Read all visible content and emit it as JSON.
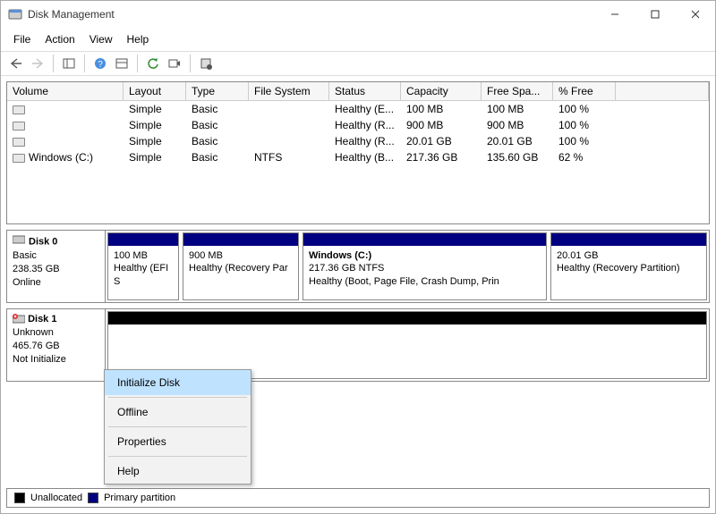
{
  "window": {
    "title": "Disk Management"
  },
  "menubar": {
    "file": "File",
    "action": "Action",
    "view": "View",
    "help": "Help"
  },
  "columns": {
    "volume": "Volume",
    "layout": "Layout",
    "type": "Type",
    "fs": "File System",
    "status": "Status",
    "capacity": "Capacity",
    "free": "Free Spa...",
    "pct": "% Free"
  },
  "volumes": [
    {
      "name": "",
      "layout": "Simple",
      "type": "Basic",
      "fs": "",
      "status": "Healthy (E...",
      "capacity": "100 MB",
      "free": "100 MB",
      "pct": "100 %"
    },
    {
      "name": "",
      "layout": "Simple",
      "type": "Basic",
      "fs": "",
      "status": "Healthy (R...",
      "capacity": "900 MB",
      "free": "900 MB",
      "pct": "100 %"
    },
    {
      "name": "",
      "layout": "Simple",
      "type": "Basic",
      "fs": "",
      "status": "Healthy (R...",
      "capacity": "20.01 GB",
      "free": "20.01 GB",
      "pct": "100 %"
    },
    {
      "name": "Windows (C:)",
      "layout": "Simple",
      "type": "Basic",
      "fs": "NTFS",
      "status": "Healthy (B...",
      "capacity": "217.36 GB",
      "free": "135.60 GB",
      "pct": "62 %"
    }
  ],
  "disk0": {
    "name": "Disk 0",
    "type": "Basic",
    "size": "238.35 GB",
    "state": "Online",
    "parts": [
      {
        "title": "",
        "line1": "100 MB",
        "line2": "Healthy (EFI S"
      },
      {
        "title": "",
        "line1": "900 MB",
        "line2": "Healthy (Recovery Par"
      },
      {
        "title": "Windows  (C:)",
        "line1": "217.36 GB NTFS",
        "line2": "Healthy (Boot, Page File, Crash Dump, Prin"
      },
      {
        "title": "",
        "line1": "20.01 GB",
        "line2": "Healthy (Recovery Partition)"
      }
    ]
  },
  "disk1": {
    "name": "Disk 1",
    "type": "Unknown",
    "size": "465.76 GB",
    "state": "Not Initialize"
  },
  "context_menu": {
    "initialize": "Initialize Disk",
    "offline": "Offline",
    "properties": "Properties",
    "help": "Help"
  },
  "legend": {
    "unallocated": "Unallocated",
    "primary": "Primary partition"
  }
}
